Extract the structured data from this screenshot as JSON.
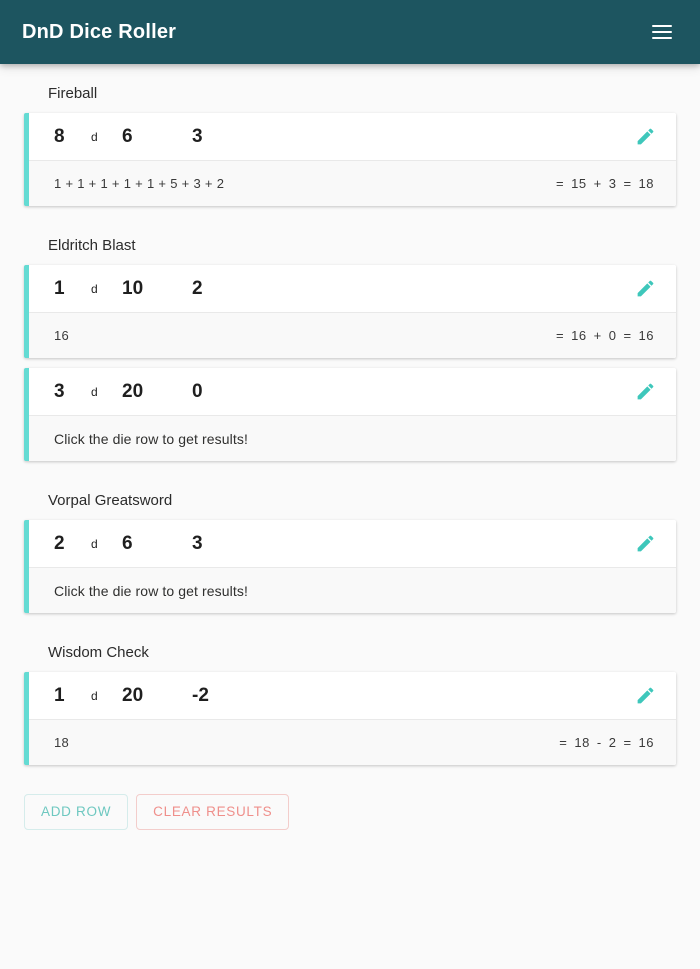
{
  "header": {
    "title": "DnD Dice Roller",
    "menu_icon": "hamburger-menu-icon",
    "brand_color": "#1d5560"
  },
  "theme": {
    "accent_teal": "#64dbd3",
    "edit_icon_color": "#3ec7bb",
    "add_row_color": "#6ec8c0",
    "clear_results_color": "#ef8f8b",
    "page_background": "#fafafa",
    "card_background": "#ffffff",
    "result_background": "#f9f9f9"
  },
  "labels": {
    "dee": "d",
    "equals": "=",
    "edit_icon": "pencil-edit-icon",
    "no_results": "Click the die row to get results!"
  },
  "groups": [
    {
      "title": "Fireball",
      "rows": [
        {
          "count": "8",
          "dee": "d",
          "sides": "6",
          "modifier": "3",
          "rolls": "1 + 1 + 1 + 1 + 1 + 5 + 3 + 2",
          "has_result": true,
          "subtotal": "15",
          "operator": "+",
          "mod_value": "3",
          "total": "18"
        }
      ]
    },
    {
      "title": "Eldritch Blast",
      "rows": [
        {
          "count": "1",
          "dee": "d",
          "sides": "10",
          "modifier": "2",
          "rolls": "16",
          "has_result": true,
          "subtotal": "16",
          "operator": "+",
          "mod_value": "0",
          "total": "16"
        },
        {
          "count": "3",
          "dee": "d",
          "sides": "20",
          "modifier": "0",
          "rolls": "Click the die row to get results!",
          "has_result": false,
          "subtotal": "",
          "operator": "",
          "mod_value": "",
          "total": ""
        }
      ]
    },
    {
      "title": "Vorpal Greatsword",
      "rows": [
        {
          "count": "2",
          "dee": "d",
          "sides": "6",
          "modifier": "3",
          "rolls": "Click the die row to get results!",
          "has_result": false,
          "subtotal": "",
          "operator": "",
          "mod_value": "",
          "total": ""
        }
      ]
    },
    {
      "title": "Wisdom Check",
      "rows": [
        {
          "count": "1",
          "dee": "d",
          "sides": "20",
          "modifier": "-2",
          "rolls": "18",
          "has_result": true,
          "subtotal": "18",
          "operator": "-",
          "mod_value": "2",
          "total": "16"
        }
      ]
    }
  ],
  "actions": {
    "add_row_label": "ADD ROW",
    "clear_results_label": "CLEAR RESULTS"
  }
}
